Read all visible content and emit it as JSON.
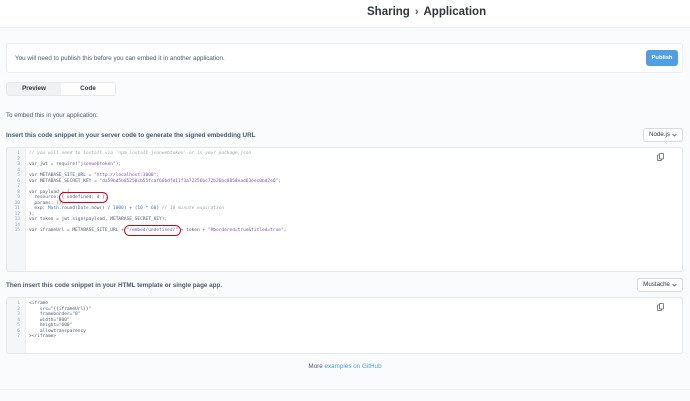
{
  "header": {
    "crumb": "Sharing",
    "page": "Application"
  },
  "notice": {
    "text": "You will need to publish this before you can embed it in another application.",
    "publish_label": "Publish"
  },
  "toggle": {
    "preview": "Preview",
    "code": "Code",
    "active": "Code"
  },
  "embed_title": "To embed this in your application:",
  "server": {
    "label": "Insert this code snippet in your server code to generate the signed embedding URL",
    "language": "Node.js",
    "lines": [
      {
        "n": "1",
        "t": "// you will need to install via 'npm install jsonwebtoken' or in your package.json"
      },
      {
        "n": "2",
        "t": ""
      },
      {
        "n": "3",
        "t": "var jwt = require(\"jsonwebtoken\");"
      },
      {
        "n": "4",
        "t": ""
      },
      {
        "n": "5",
        "t": "var METABASE_SITE_URL = \"http://localhost:3000\";"
      },
      {
        "n": "6",
        "t": "var METABASE_SECRET_KEY = \"da59bd5b85250cb55fcaf66bdfd11f3a72256bc72b26bc8858ead63eec0bd2e6\";"
      },
      {
        "n": "7",
        "t": ""
      },
      {
        "n": "8",
        "t": "var payload = {"
      },
      {
        "n": "9",
        "t": "  resource: { undefined: 4 },"
      },
      {
        "n": "10",
        "t": "  params: {},"
      },
      {
        "n": "11",
        "t": "  exp: Math.round(Date.now() / 1000) + (10 * 60) // 10 minute expiration"
      },
      {
        "n": "12",
        "t": "};"
      },
      {
        "n": "13",
        "t": "var token = jwt.sign(payload, METABASE_SECRET_KEY);"
      },
      {
        "n": "14",
        "t": ""
      },
      {
        "n": "15",
        "t": "var iframeUrl = METABASE_SITE_URL + \"/embed/undefined/\" + token + \"#bordered=true&titled=true\";"
      }
    ],
    "parts": {
      "v": "var ",
      "require_pre": "jwt = require(",
      "require_str": "\"jsonwebtoken\"",
      "close": ");",
      "site_pre": "METABASE_SITE_URL = ",
      "site_str": "\"http://localhost:3000\"",
      "semi": ";",
      "key_pre": "METABASE_SECRET_KEY = ",
      "key_str": "\"da59bd5b85250cb55fcaf66bdfd11f3a72256bc72b26bc8858ead63eec0bd2e6\"",
      "payload": "payload = {",
      "res_pre": "  resource: ",
      "res_hl": "{ undefined: 4 }",
      "comma": ",",
      "params": "  params: {},",
      "exp_pre": "  exp: ",
      "math": "Math",
      "round_pre": ".round(",
      "date": "Date",
      "now": ".now() / ",
      "n1000": "1000",
      "paren": ") + (",
      "n10": "10",
      "times": " * ",
      "n60": "60",
      "closeparen": ") ",
      "exp_comment": "// 10 minute expiration",
      "end": "};",
      "token": "token = jwt.sign(payload, METABASE_SECRET_KEY);",
      "iframe_pre": "iframeUrl = METABASE_SITE_URL + ",
      "iframe_hl": "\"/embed/undefined/\"",
      "token_plus": " + token + ",
      "hash_str": "\"#bordered=true&titled=true\""
    }
  },
  "html": {
    "label": "Then insert this code snippet in your HTML template or single page app.",
    "language": "Mustache",
    "lines": [
      {
        "n": "1",
        "t": "<iframe"
      },
      {
        "n": "2",
        "t": "    src=\"{{iframeUrl}}\""
      },
      {
        "n": "3",
        "t": "    frameborder=\"0\""
      },
      {
        "n": "4",
        "t": "    width=\"800\""
      },
      {
        "n": "5",
        "t": "    height=\"600\""
      },
      {
        "n": "6",
        "t": "    allowtransparency"
      },
      {
        "n": "7",
        "t": "></iframe>"
      }
    ]
  },
  "footer": {
    "pre": "More ",
    "link": "examples on GitHub"
  },
  "colors": {
    "accent": "#509ee3",
    "annotation": "#d0021b"
  },
  "icons": {
    "chevron": "chevron-right-icon",
    "copy": "copy-icon",
    "dropdown": "chevron-down-icon"
  }
}
